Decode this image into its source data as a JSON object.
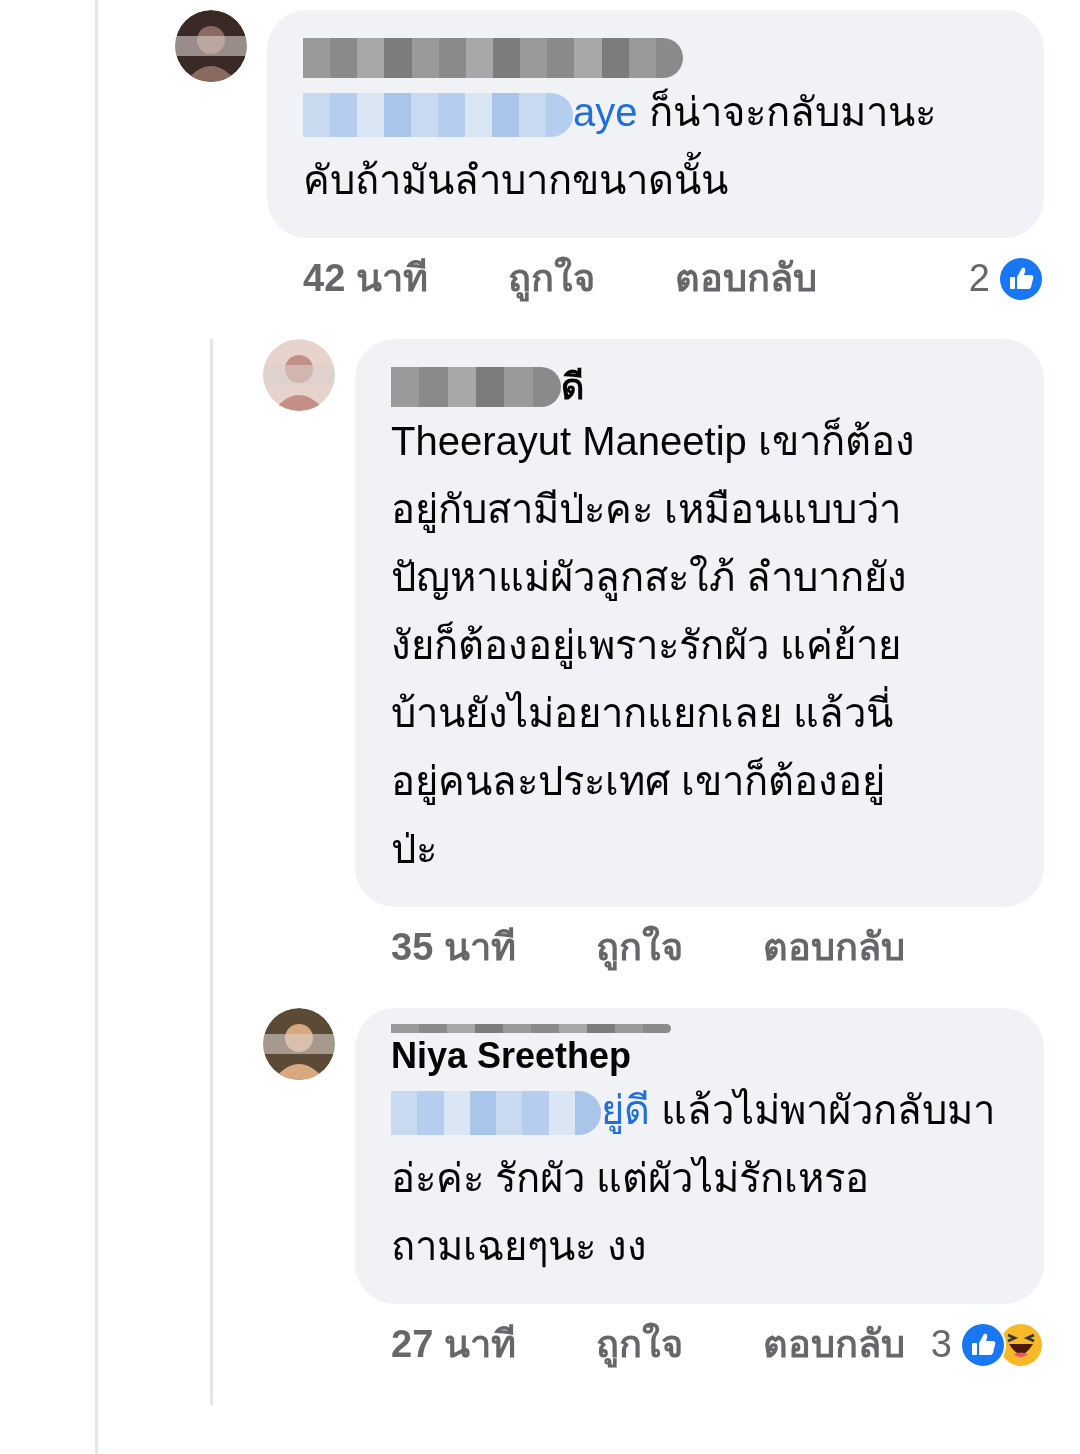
{
  "comment": {
    "mention": "aye",
    "lines": [
      " ก็น่าจะกลับมานะ",
      "คับถ้ามันลำบากขนาดนั้น"
    ],
    "time": "42 นาที",
    "like": "ถูกใจ",
    "reply": "ตอบกลับ",
    "reaction_count": "2",
    "reactions": [
      {
        "kind": "like"
      }
    ],
    "replies": [
      {
        "name": "ดี",
        "name_covered": true,
        "lines": [
          "Theerayut Maneetip เขาก็ต้อง",
          "อยู่กับสามีป่ะคะ เหมือนแบบว่า",
          "ปัญหาแม่ผัวลูกสะใภ้ ลำบากยัง",
          "งัยก็ต้องอยู่เพราะรักผัว แค่ย้าย",
          "บ้านยังไม่อยากแยกเลย แล้วนี่",
          "อยู่คนละประเทศ เขาก็ต้องอยู่",
          "ป่ะ"
        ],
        "time": "35 นาที",
        "like": "ถูกใจ",
        "reply": "ตอบกลับ"
      },
      {
        "name": "Niya Sreethep",
        "name_covered": false,
        "mention": "ยู่ดี",
        "lines": [
          " แล้วไม่พาผัวกลับมา",
          "อ่ะค่ะ รักผัว แต่ผัวไม่รักเหรอ",
          "ถามเฉยๆนะ งง"
        ],
        "time": "27 นาที",
        "like": "ถูกใจ",
        "reply": "ตอบกลับ",
        "reaction_count": "3",
        "reactions": [
          {
            "kind": "like"
          },
          {
            "kind": "haha"
          }
        ]
      }
    ]
  }
}
